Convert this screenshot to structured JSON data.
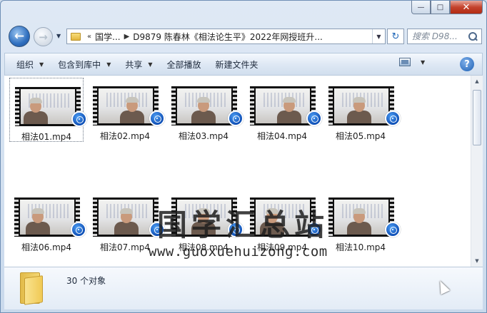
{
  "window": {
    "minimize_glyph": "—",
    "maximize_glyph": "□",
    "close_glyph": "✕"
  },
  "nav": {
    "back_glyph": "←",
    "forward_glyph": "→",
    "history_glyph": "▼",
    "refresh_glyph": "↻",
    "address_overflow": "«",
    "breadcrumb": [
      "国学...",
      "D9879 陈春林《相法论生平》2022年网授班升..."
    ],
    "search_placeholder": "搜索 D98..."
  },
  "toolbar": {
    "items": [
      "组织",
      "包含到库中",
      "共享",
      "全部播放",
      "新建文件夹"
    ],
    "has_dropdown": [
      true,
      true,
      true,
      false,
      false
    ],
    "help_glyph": "?"
  },
  "files": [
    {
      "name": "相法01.mp4"
    },
    {
      "name": "相法02.mp4"
    },
    {
      "name": "相法03.mp4"
    },
    {
      "name": "相法04.mp4"
    },
    {
      "name": "相法05.mp4"
    },
    {
      "name": "相法06.mp4"
    },
    {
      "name": "相法07.mp4"
    },
    {
      "name": "相法08.mp4"
    },
    {
      "name": "相法09.mp4"
    },
    {
      "name": "相法10.mp4"
    }
  ],
  "selected_index": 0,
  "watermark": {
    "title": "国学汇总站",
    "url": "www.guoxuehuizong.com"
  },
  "details": {
    "count_text": "30 个对象"
  },
  "colors": {
    "accent": "#1c5fb4",
    "close": "#c4432d",
    "folder": "#f0c955"
  },
  "scroll": {
    "vertical_position": 0.0
  }
}
